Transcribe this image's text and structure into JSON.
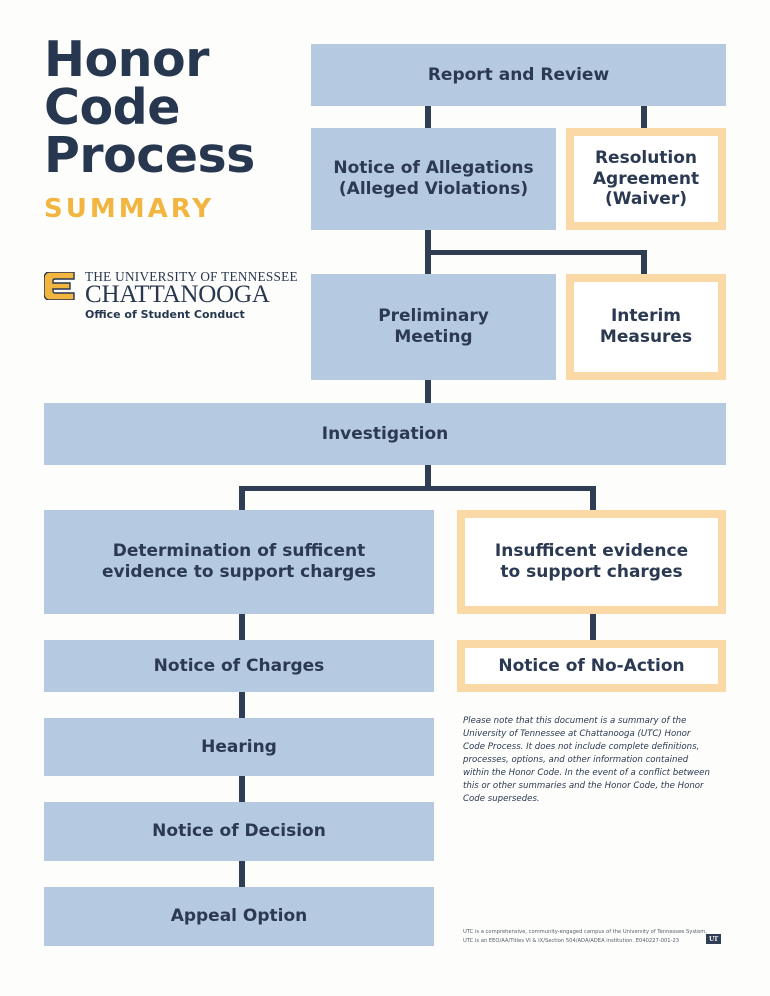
{
  "header": {
    "title_line1": "Honor",
    "title_line2": "Code",
    "title_line3": "Process",
    "subtitle": "SUMMARY"
  },
  "logo": {
    "line1": "THE UNIVERSITY OF TENNESSEE",
    "line2": "CHATTANOOGA",
    "line3": "Office of Student Conduct",
    "mark": "power-c-icon"
  },
  "colors": {
    "navy": "#27374f",
    "gold": "#f2b540",
    "box_blue": "#b5c9e0",
    "box_amber_border": "#fad9a6",
    "connector": "#2f3e54",
    "page_background": "#fdfdfb"
  },
  "flow": {
    "nodes": [
      {
        "id": "report-and-review",
        "label": "Report and Review",
        "style": "filled"
      },
      {
        "id": "notice-of-allegations",
        "label": "Notice of Allegations\n(Alleged Violations)",
        "style": "filled"
      },
      {
        "id": "resolution-agreement",
        "label": "Resolution\nAgreement\n(Waiver)",
        "style": "outlined"
      },
      {
        "id": "preliminary-meeting",
        "label": "Preliminary\nMeeting",
        "style": "filled"
      },
      {
        "id": "interim-measures",
        "label": "Interim\nMeasures",
        "style": "outlined"
      },
      {
        "id": "investigation",
        "label": "Investigation",
        "style": "filled"
      },
      {
        "id": "determination-of-sufficient",
        "label": "Determination of sufficent\nevidence to support charges",
        "style": "filled"
      },
      {
        "id": "insufficient-evidence",
        "label": "Insufficent evidence\nto support charges",
        "style": "outlined"
      },
      {
        "id": "notice-of-charges",
        "label": "Notice of Charges",
        "style": "filled"
      },
      {
        "id": "notice-of-no-action",
        "label": "Notice of No-Action",
        "style": "outlined"
      },
      {
        "id": "hearing",
        "label": "Hearing",
        "style": "filled"
      },
      {
        "id": "notice-of-decision",
        "label": "Notice of Decision",
        "style": "filled"
      },
      {
        "id": "appeal-option",
        "label": "Appeal Option",
        "style": "filled"
      }
    ]
  },
  "disclaimer": "Please note that this document is a summary of the University of Tennessee at Chattanooga (UTC) Honor Code Process. It does not include complete definitions, processes, options, and other information contained within the Honor Code. In the event of a conflict between this or other summaries and the Honor Code, the Honor Code supersedes.",
  "footer": {
    "line1": "UTC is a comprehensive, community-engaged campus of the University of Tennessee System.",
    "line2": "UTC is an EEO/AA/Titles VI & IX/Section 504/ADA/ADEA institution. E040227-001-23",
    "mark": "UT"
  }
}
